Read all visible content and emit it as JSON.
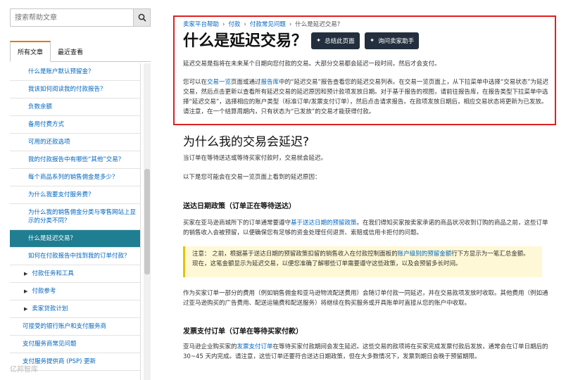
{
  "search": {
    "placeholder": "搜索帮助文章"
  },
  "tabs": {
    "all": "所有文章",
    "recent": "最近查看"
  },
  "sidebar_items": [
    {
      "label": "什么是账户默认预留金？",
      "kind": "item"
    },
    {
      "label": "我该如何阅读我的付款报告？",
      "kind": "item"
    },
    {
      "label": "负数余额",
      "kind": "item"
    },
    {
      "label": "备用付费方式",
      "kind": "item"
    },
    {
      "label": "可用的还款选项",
      "kind": "item"
    },
    {
      "label": "我的付款报告中有哪些“其他”交易？",
      "kind": "item"
    },
    {
      "label": "每个商品系列的销售佣金是多少？",
      "kind": "item"
    },
    {
      "label": "为什么我要支付服务费？",
      "kind": "item"
    },
    {
      "label": "为什么我的销售佣金分类与零售网站上显示的分类不同？",
      "kind": "item"
    },
    {
      "label": "什么是延迟交易？",
      "kind": "selected"
    },
    {
      "label": "如何在付款报告中找到我的订单付款？",
      "kind": "item"
    },
    {
      "label": "付款任务和工具",
      "kind": "group"
    },
    {
      "label": "付款参考",
      "kind": "group"
    },
    {
      "label": "卖家贷款计划",
      "kind": "group"
    },
    {
      "label": "可接受的银行账户和支付服务商",
      "kind": "top"
    },
    {
      "label": "支付服务商常见问题",
      "kind": "top"
    },
    {
      "label": "支付服务提供商 (PSP) 更新",
      "kind": "top"
    }
  ],
  "breadcrumb": [
    "卖家平台帮助",
    "付款",
    "付款常见问题",
    "什么是延迟交易?"
  ],
  "title": "什么是延迟交易？",
  "buttons": {
    "summary": "总结此页面",
    "ask": "询问卖家助手"
  },
  "intro": "延迟交易是指将在未来某个日期向您付款的交易。大部分交易都会延迟一段时间，然后才会支付。",
  "para2": {
    "p1": "您可以在",
    "link1": "交易一览",
    "p2": "页面或通过",
    "link2": "报告库",
    "p3": "中的“延迟交易”报告查看您的延迟交易列表。在交易一览页面上，从下拉菜单中选择“交易状态”为延迟交易，然后点击更新以查看所有延迟交易的延迟原因和预计款项发放日期。对于基于报告的视图，请前往报告库，在报告类型下拉菜单中选择“延迟交易”，选择相应的账户类型（标准订单/发票支付订单），然后点击请求报告。在款项发放日期后，相应交易状态将更新为已发放。请注意，在一个结算周期内，只有状态为“已发放”的交易才能获得付款。"
  },
  "section": {
    "heading": "为什么我的交易会延迟?",
    "line1": "当订单在等待送达或等待买家付款时，交易就会延迟。",
    "line2": "以下是您可能会在交易一览页面上看到的延迟原因："
  },
  "delivery": {
    "heading": "送达日期政策（订单正在等待送达）",
    "p1": "买家在亚马逊商城所下的订单通常要遵守",
    "link": "基于送达日期的预留政策",
    "p2": "。在我们得知买家按卖家承诺的商品状况收到订购的商品之前，这些订单的销售收入会被预留，以便确保您有足够的资金处理任何退货、索赔或信用卡拒付的问题。"
  },
  "note": {
    "p1": "注意：  之前，根据基于送达日期的预留政策扣留的销售收入在付款控制面板的",
    "link": "账户级别的预留金额",
    "p2": "行下方显示为一笔汇总金额。现在，这笔金额显示为延迟交易，以便您准确了解哪些订单需要遵守这些政策，以及会预留多长时间。"
  },
  "fees_para": "作为买家订单一部分的费用（例如销售佣金和亚马逊物流配送费用）会随订单付款一同延迟，并在交易款项发放时收取。其他费用（例如通过亚马逊购买的广告费用、配送运输费和配送服务）将继续在购买服务或开具账单时直接从您的账户中收取。",
  "invoice": {
    "heading": "发票支付订单（订单在等待买家付款）",
    "p1": "亚马逊企业购买家的",
    "link": "发票支付订单",
    "p2": "在等待买家付款期间会发生延迟。这些交易的款项将在买家完成发票付款后发放，通常会在订单日期后的 30~45 天内完成。请注意，这些订单还要符合送达日期政策，但在大多数情况下，发票到期日会晚于预留期限。"
  },
  "watermark": "亿邦智库"
}
